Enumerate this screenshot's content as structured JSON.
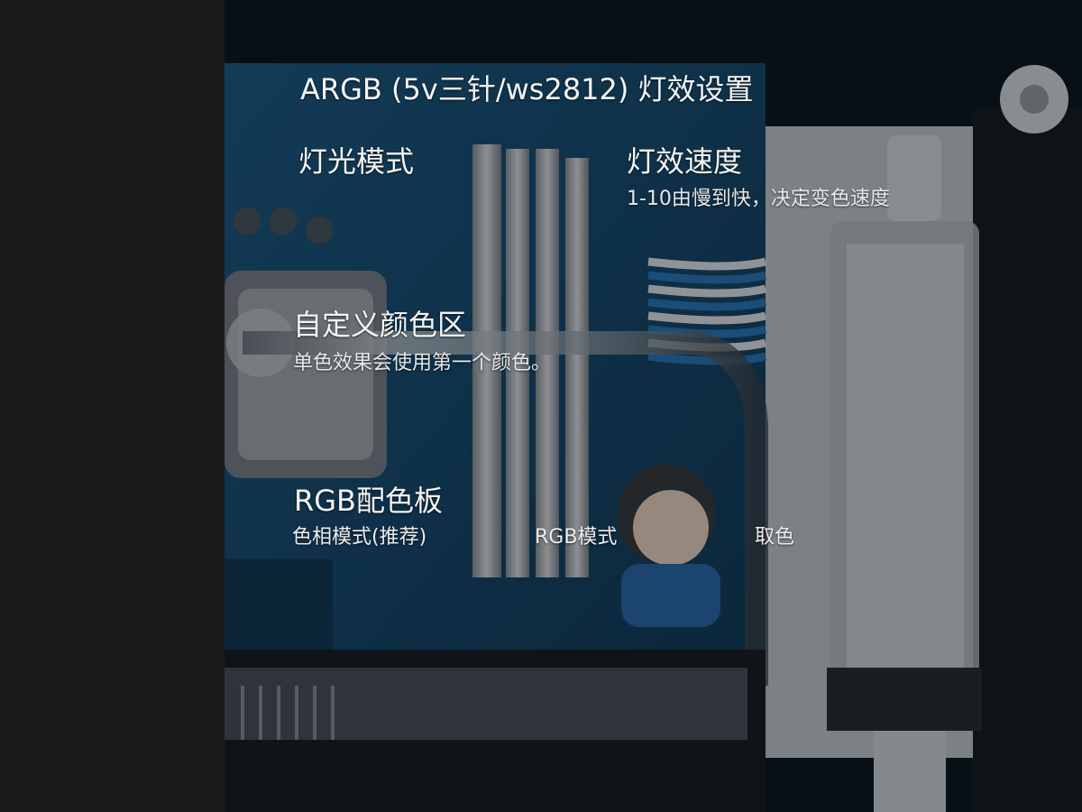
{
  "page": {
    "title": "ARGB (5v三针/ws2812) 灯效设置"
  },
  "light_mode": {
    "heading": "灯光模式"
  },
  "light_speed": {
    "heading": "灯效速度",
    "description": "1-10由慢到快，决定变色速度"
  },
  "custom_color": {
    "heading": "自定义颜色区",
    "description": "单色效果会使用第一个颜色。"
  },
  "palette": {
    "heading": "RGB配色板",
    "options": [
      "色相模式(推荐)",
      "RGB模式",
      "取色"
    ]
  },
  "colors": {
    "sidebar_bg": "#1b1b1b",
    "text": "#f4f4f4",
    "pcb_blue": "#1d5a86",
    "dark_bg": "#0b1620"
  }
}
